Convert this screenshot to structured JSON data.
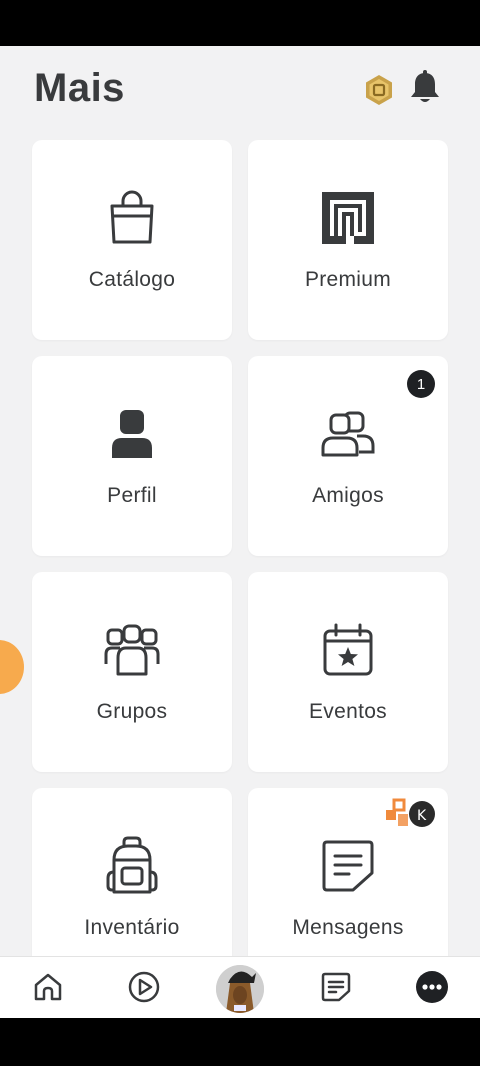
{
  "header": {
    "title": "Mais",
    "robux_icon": "robux-icon",
    "notification_icon": "bell-icon"
  },
  "tiles": [
    {
      "label": "Catálogo",
      "icon": "shopping-bag-icon"
    },
    {
      "label": "Premium",
      "icon": "premium-icon"
    },
    {
      "label": "Perfil",
      "icon": "profile-icon"
    },
    {
      "label": "Amigos",
      "icon": "friends-icon",
      "badge": "1"
    },
    {
      "label": "Grupos",
      "icon": "groups-icon"
    },
    {
      "label": "Eventos",
      "icon": "calendar-star-icon"
    },
    {
      "label": "Inventário",
      "icon": "backpack-icon"
    },
    {
      "label": "Mensagens",
      "icon": "message-icon"
    }
  ],
  "navbar": {
    "items": [
      "home-icon",
      "play-icon",
      "avatar",
      "chat-icon",
      "more-icon"
    ]
  },
  "colors": {
    "background": "#f2f2f3",
    "tile": "#ffffff",
    "text": "#393b3d",
    "badge": "#1f2124",
    "robux_gold": "#c9a24a"
  }
}
